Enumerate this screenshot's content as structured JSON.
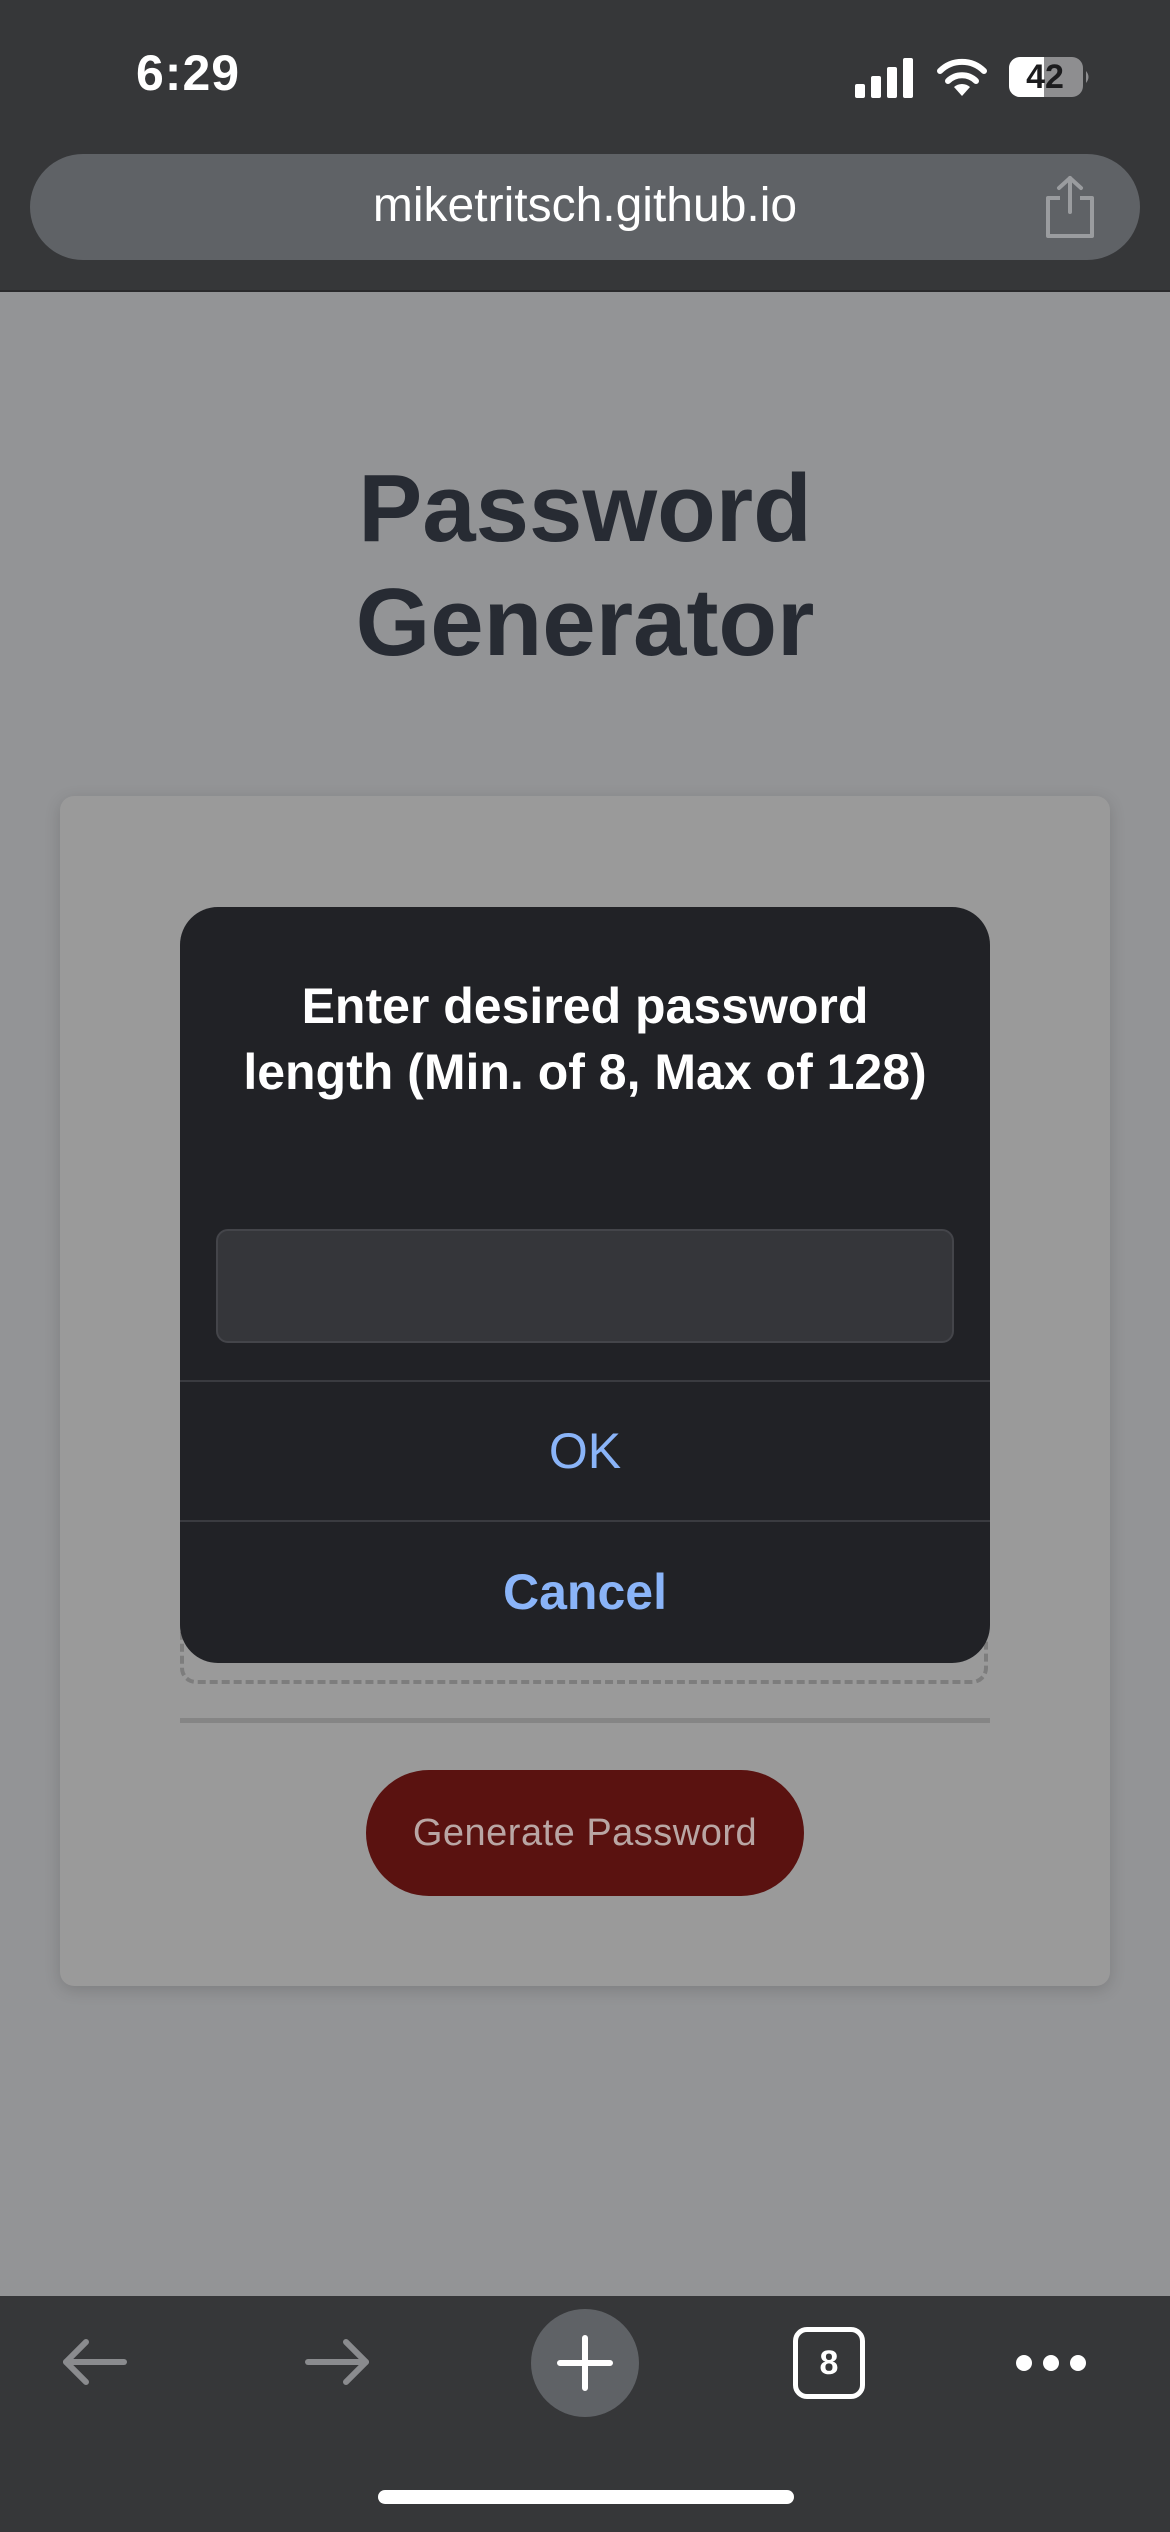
{
  "status_bar": {
    "time": "6:29",
    "battery": "42",
    "icons": [
      "signal-icon",
      "wifi-icon",
      "battery-icon"
    ]
  },
  "browser": {
    "url": "miketritsch.github.io",
    "share_icon": "share-icon"
  },
  "page": {
    "title_line1": "Password",
    "title_line2": "Generator",
    "generate_button_label": "Generate Password"
  },
  "dialog": {
    "message": "Enter desired password length (Min. of 8, Max of 128)",
    "input_value": "",
    "ok_label": "OK",
    "cancel_label": "Cancel"
  },
  "toolbar": {
    "tab_count": "8",
    "icons": [
      "back-arrow-icon",
      "forward-arrow-icon",
      "plus-icon",
      "tabs-icon",
      "more-icon"
    ]
  },
  "colors": {
    "dialog_background": "#212226",
    "dialog_button_text": "#8ab4f8",
    "page_dimmed_background": "#939496",
    "generate_button": "#5a1210",
    "title_text": "#272b33"
  }
}
